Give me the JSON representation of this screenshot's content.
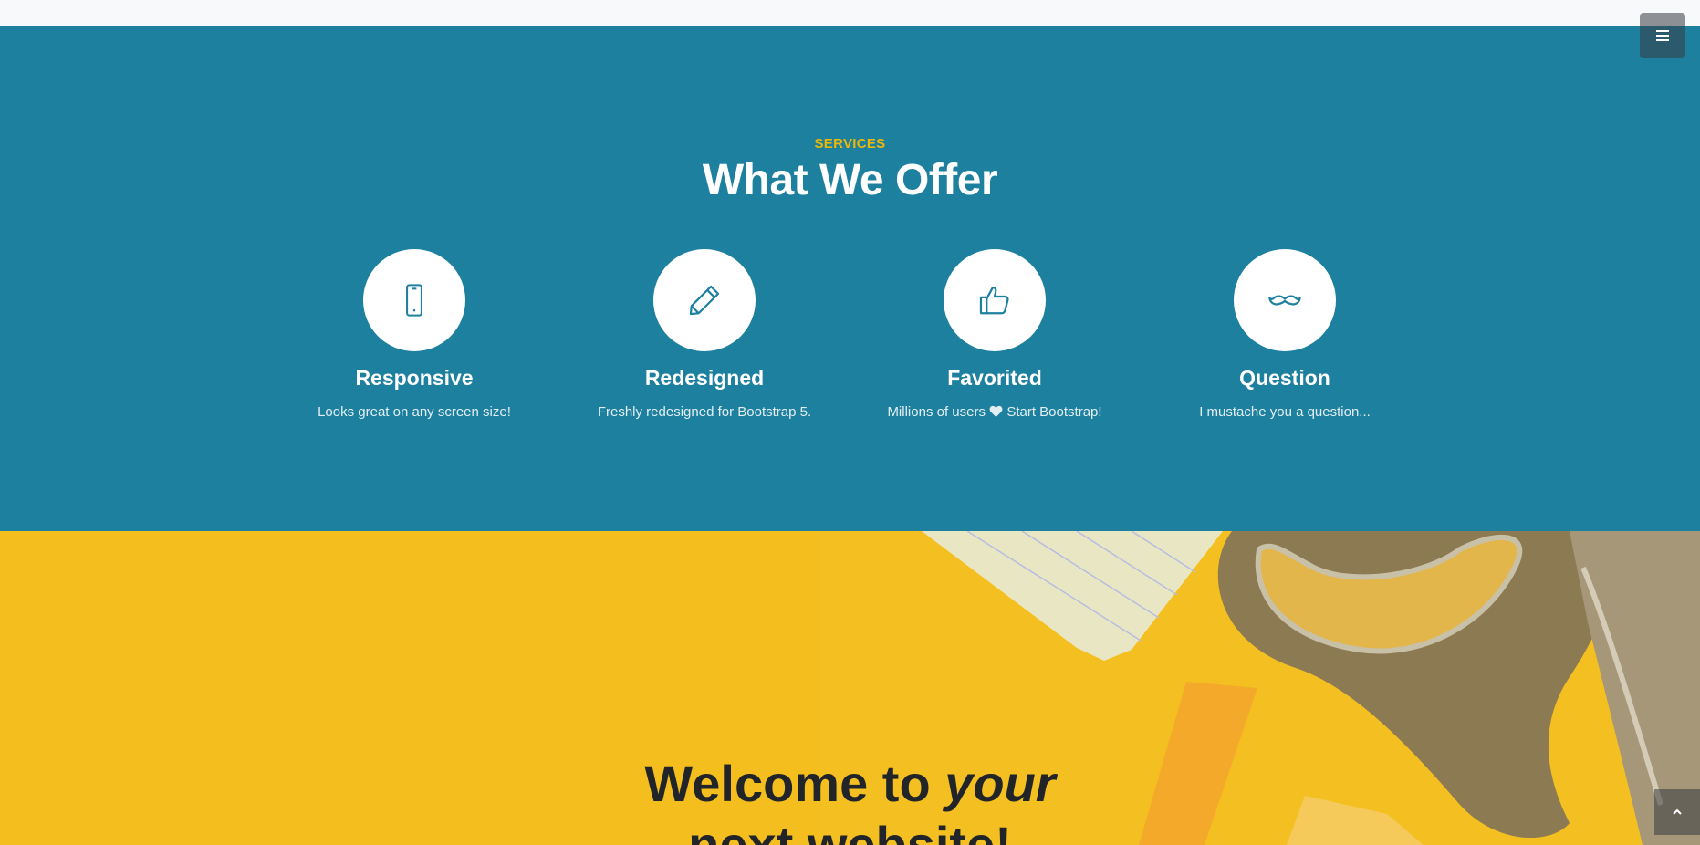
{
  "menu_toggle": {
    "icon": "hamburger-icon"
  },
  "services": {
    "subheading": "SERVICES",
    "heading": "What We Offer",
    "items": [
      {
        "icon": "mobile-phone-icon",
        "title": "Responsive",
        "text": "Looks great on any screen size!"
      },
      {
        "icon": "pencil-icon",
        "title": "Redesigned",
        "text": "Freshly redesigned for Bootstrap 5."
      },
      {
        "icon": "thumbs-up-icon",
        "title": "Favorited",
        "text_before": "Millions of users",
        "text_after": "Start Bootstrap!"
      },
      {
        "icon": "mustache-icon",
        "title": "Question",
        "text": "I mustache you a question..."
      }
    ]
  },
  "hero": {
    "title_start": "Welcome to ",
    "title_em": "your",
    "title_end": "next website!"
  },
  "scroll_top": {
    "icon": "chevron-up-icon"
  },
  "colors": {
    "services_bg": "#1d809f",
    "accent_yellow": "#ecb807",
    "hero_bg": "#f4c021",
    "icon_blue": "#1d809f"
  }
}
